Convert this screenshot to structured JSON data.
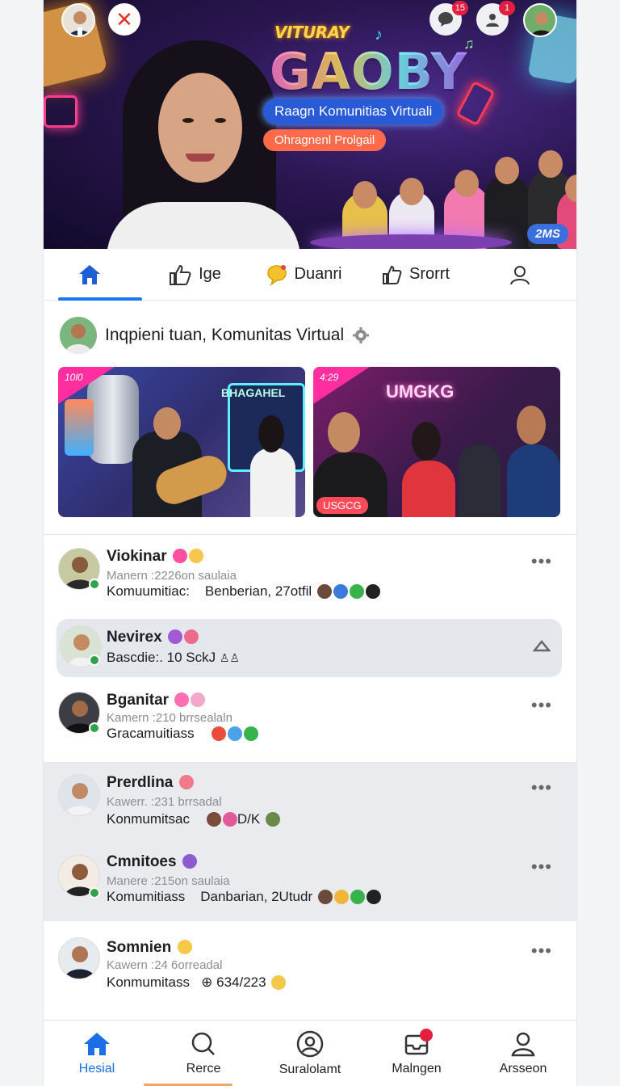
{
  "hero": {
    "word_top": "VITURAY",
    "word_main": "GAOBY",
    "pill_primary": "Raagn Komunitias Virtuali",
    "pill_secondary": "Ohragnenl Prolgail",
    "badge": "2MS",
    "notif_1": "15",
    "notif_2": "1"
  },
  "tabs": [
    {
      "label": ""
    },
    {
      "label": "Ige"
    },
    {
      "label": "Duanri"
    },
    {
      "label": "Srorrt"
    },
    {
      "label": ""
    }
  ],
  "community": {
    "title": "Inqpieni tuan, Komunitas Virtual",
    "card1": {
      "tag": "10l0",
      "sign": "BHAGAHEL"
    },
    "card2": {
      "tag": "4:29",
      "sign": "UMGKG",
      "label": "USGCG"
    }
  },
  "feed": [
    {
      "name": "Viokinar",
      "meta": "Manern :2226on saulaia",
      "sub": "Komuumitiac:",
      "sub2": "Benberian, 27otfil"
    },
    {
      "name": "Nevirex",
      "meta": "",
      "sub": "Bascdie:. 10 SckJ",
      "sub2": ""
    },
    {
      "name": "Bganitar",
      "meta": "Kamern :210 brrsealaln",
      "sub": "Gracamuitiass",
      "sub2": ""
    },
    {
      "name": "Prerdlina",
      "meta": "Kawerr. :231 brrsadal",
      "sub": "Konmumitsac",
      "sub2": "D/K"
    },
    {
      "name": "Cmnitoes",
      "meta": "Manere :215on saulaia",
      "sub": "Komumitiass",
      "sub2": "Danbarian, 2Utudr"
    },
    {
      "name": "Somnien",
      "meta": "Kawern :24 6orreadal",
      "sub": "Konmumitass",
      "sub2": "634/223"
    }
  ],
  "bottom_nav": [
    {
      "label": "Hesial"
    },
    {
      "label": "Rerce"
    },
    {
      "label": "Suralolamt"
    },
    {
      "label": "Malngen"
    },
    {
      "label": "Arsseon"
    }
  ],
  "colors": {
    "accent": "#1877f2",
    "online": "#31a24c",
    "alert": "#e41e3f"
  }
}
